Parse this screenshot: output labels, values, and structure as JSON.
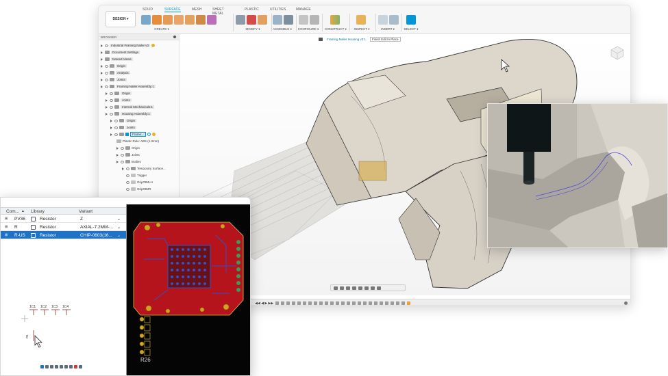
{
  "cad": {
    "design_label": "DESIGN ▾",
    "workspace_tabs": [
      "SOLID",
      "SURFACE",
      "MESH",
      "SHEET METAL",
      "PLASTIC",
      "UTILITIES",
      "MANAGE"
    ],
    "tool_groups": [
      "CREATE ▾",
      "MODIFY ▾",
      "ASSEMBLE ▾",
      "CONFIGURE ▾",
      "CONSTRUCT ▾",
      "INSPECT ▾",
      "INSERT ▾",
      "SELECT ▾"
    ],
    "browser_title": "BROWSER",
    "tree": [
      "Industrial Framing Nailer v3",
      "Document Settings",
      "Named Views",
      "Origin",
      "Analysis",
      "Joints",
      "Framing Nailer Assembly:1",
      "Origin",
      "Joints",
      "Internal Mechanicals:1",
      "Housing Assembly:1",
      "Origin",
      "Joints",
      "Frame...",
      "Plastic Rule: ABS (1.0mm)",
      "Origin",
      "Joints",
      "Bodies",
      "Temporary Surface...",
      "Trigger",
      "GripOtMLH",
      "GripOtMR"
    ],
    "edit_in_place_label": "Framing Nailer Housing v3:1",
    "finish_edit_label": "Finish Edit In Place",
    "accent_color": "#0696d7"
  },
  "electronics": {
    "columns": [
      "Com...",
      "Library",
      "Variant"
    ],
    "rows": [
      {
        "name": "PV36",
        "library": "Resistor",
        "variant": "Z"
      },
      {
        "name": "R",
        "library": "Resistor",
        "variant": "AXIAL-7.2MM-..."
      },
      {
        "name": "R-US",
        "library": "Resistor",
        "variant": "CHIP-0603(16..."
      }
    ],
    "schematic_labels": [
      "1C1",
      "1C2",
      "1C3",
      "1C4"
    ],
    "part_label": "R1",
    "pcb_label": "R26",
    "selected_color": "#1e73c8"
  }
}
